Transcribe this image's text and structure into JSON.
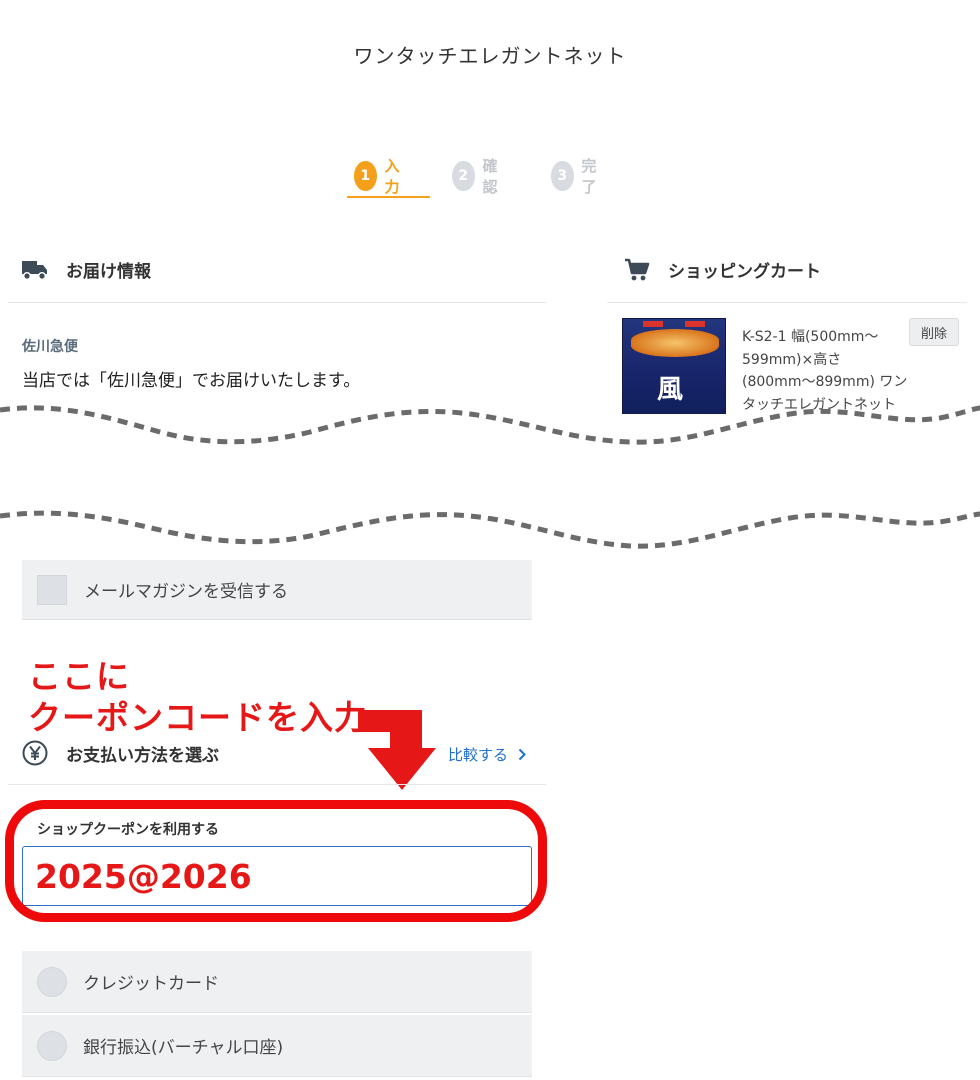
{
  "header": {
    "shop_title": "ワンタッチエレガントネット"
  },
  "steps": [
    {
      "num": "1",
      "label": "入力",
      "state": "active"
    },
    {
      "num": "2",
      "label": "確認",
      "state": "inactive"
    },
    {
      "num": "3",
      "label": "完了",
      "state": "inactive"
    }
  ],
  "delivery": {
    "heading": "お届け情報",
    "icon": "truck-icon",
    "carrier": "佐川急便",
    "description": "当店では「佐川急便」でお届けいたします。"
  },
  "cart": {
    "heading": "ショッピングカート",
    "icon": "cart-icon",
    "item_name": "K-S2-1 幅(500mm〜599mm)×高さ(800mm〜899mm) ワンタッチエレガントネット",
    "delete_label": "削除"
  },
  "newsletter": {
    "label": "メールマガジンを受信する"
  },
  "annotation": {
    "line1": "ここに",
    "line2": "クーポンコードを入力",
    "color": "#e61717"
  },
  "payment": {
    "heading": "お支払い方法を選ぶ",
    "icon": "yen-icon",
    "compare_label": "比較する",
    "coupon_label": "ショップクーポンを利用する",
    "coupon_value": "2025@2026",
    "options": [
      "クレジットカード",
      "銀行振込(バーチャル口座)"
    ]
  },
  "colors": {
    "accent": "#f5a01a",
    "link": "#1f6fce",
    "annotation_red": "#ee0a0a"
  }
}
